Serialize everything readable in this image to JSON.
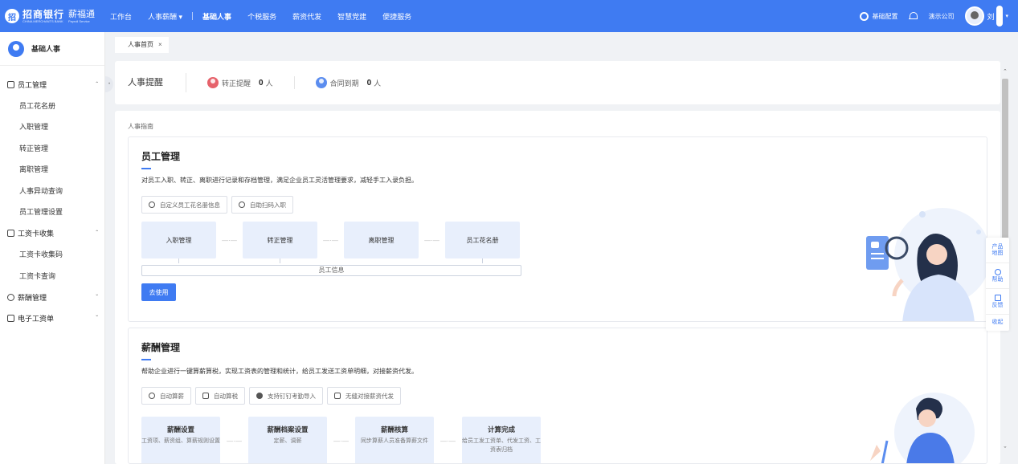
{
  "header": {
    "brand_logo": "招",
    "brand_name": "招商银行",
    "brand_sub": "CHINA MERCHANTS BANK",
    "product_name": "薪福通",
    "product_sub": "Payroll Service",
    "nav": [
      {
        "label": "工作台"
      },
      {
        "label": "人事薪酬 ▾"
      },
      {
        "label": "基础人事"
      },
      {
        "label": "个税服务"
      },
      {
        "label": "薪资代发"
      },
      {
        "label": "智慧党建"
      },
      {
        "label": "便捷服务"
      }
    ],
    "settings_label": "基础配置",
    "company_label": "演示公司",
    "user_name": "刘",
    "user_caret": "▾"
  },
  "sidebar": {
    "title": "基础人事",
    "groups": [
      {
        "label": "员工管理",
        "arrow": "ˆ",
        "items": [
          "员工花名册",
          "入职管理",
          "转正管理",
          "离职管理",
          "人事异动查询",
          "员工管理设置"
        ]
      },
      {
        "label": "工资卡收集",
        "arrow": "ˆ",
        "items": [
          "工资卡收集码",
          "工资卡查询"
        ]
      },
      {
        "label": "薪酬管理",
        "arrow": "ˇ",
        "items": []
      },
      {
        "label": "电子工资单",
        "arrow": "ˇ",
        "items": []
      }
    ],
    "collapse_glyph": "•"
  },
  "tabs": [
    {
      "label": "人事首页",
      "close": "×"
    }
  ],
  "reminder": {
    "title": "人事提醒",
    "items": [
      {
        "label": "转正提醒",
        "count": "0",
        "unit": "人",
        "color": "#e6626b"
      },
      {
        "label": "合同到期",
        "count": "0",
        "unit": "人",
        "color": "#5b8def"
      }
    ]
  },
  "guide": {
    "title": "人事指南",
    "cards": [
      {
        "title": "员工管理",
        "desc": "对员工入职、转正、离职进行记录和存档管理，满足企业员工灵活管理要求，减轻手工入录负担。",
        "features": [
          "自定义员工花名册信息",
          "自助扫码入职"
        ],
        "steps": [
          "入职管理",
          "转正管理",
          "离职管理",
          "员工花名册"
        ],
        "link_glyph": "—·—",
        "base": "员工信息",
        "button": "去使用"
      },
      {
        "title": "薪酬管理",
        "desc": "帮助企业进行一键算薪算税，实现工资表的管理和统计，给员工发送工资单明细，对接薪资代发。",
        "features": [
          "自动算薪",
          "自动算税",
          "支持钉钉考勤导入",
          "无缝对接薪资代发"
        ],
        "steps": [
          {
            "title": "薪酬设置",
            "sub": "工资项、薪资组、算薪规则设置"
          },
          {
            "title": "薪酬档案设置",
            "sub": "定薪、调薪"
          },
          {
            "title": "薪酬核算",
            "sub": "同步算薪人员准备算薪文件"
          },
          {
            "title": "计算完成",
            "sub": "给员工发工资单、代发工资、工资表归档"
          }
        ],
        "link_glyph": "—·—"
      }
    ]
  },
  "scrollbar": {
    "up": "ˆ",
    "down": "ˇ"
  },
  "float_panel": [
    {
      "line1": "产品",
      "line2": "地图"
    },
    {
      "line1": "帮助"
    },
    {
      "line1": "反馈"
    },
    {
      "line1": "收起"
    }
  ],
  "colors": {
    "primary": "#3f7bf2",
    "step_bg": "#e8effc"
  }
}
